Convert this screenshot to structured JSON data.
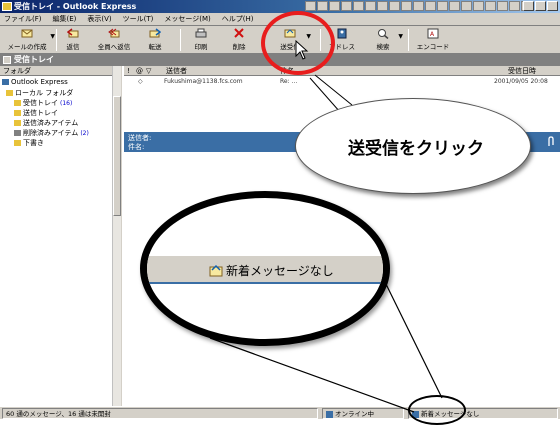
{
  "window": {
    "title": "受信トレイ - Outlook Express"
  },
  "menu": [
    "ファイル(F)",
    "編集(E)",
    "表示(V)",
    "ツール(T)",
    "メッセージ(M)",
    "ヘルプ(H)"
  ],
  "toolbar": {
    "new_mail": "メールの作成",
    "reply": "返信",
    "reply_all": "全員へ返信",
    "forward": "転送",
    "print": "印刷",
    "delete": "削除",
    "send_recv": "送受信",
    "address": "アドレス",
    "find": "検索",
    "encode": "エンコード"
  },
  "folder_bar": {
    "title": "受信トレイ"
  },
  "folders": {
    "header": "フォルダ",
    "root": "Outlook Express",
    "local": "ローカル フォルダ",
    "inbox": "受信トレイ",
    "inbox_count": "(16)",
    "outbox": "送信トレイ",
    "sent": "送信済みアイテム",
    "deleted": "削除済みアイテム",
    "deleted_count": "(2)",
    "drafts": "下書き"
  },
  "message_list": {
    "col_from": "送信者",
    "col_subject": "件名",
    "col_received": "受信日時",
    "row_from": "Fukushima@1138.fcs.com",
    "row_subject": "Re: ...",
    "row_date": "2001/09/05 20:08"
  },
  "preview": {
    "from_label": "送信者:",
    "subject_label": "件名:"
  },
  "status": {
    "message_count": "60 通のメッセージ、16 通は未開封",
    "online": "オンライン中",
    "no_new": "新着メッセージなし"
  },
  "annotation": {
    "callout": "送受信をクリック",
    "zoom_label": "新着メッセージなし"
  },
  "colors": {
    "title_bar": "#0a246a",
    "highlight_ring": "#e81d1d",
    "preview_header": "#3a6ea5"
  }
}
